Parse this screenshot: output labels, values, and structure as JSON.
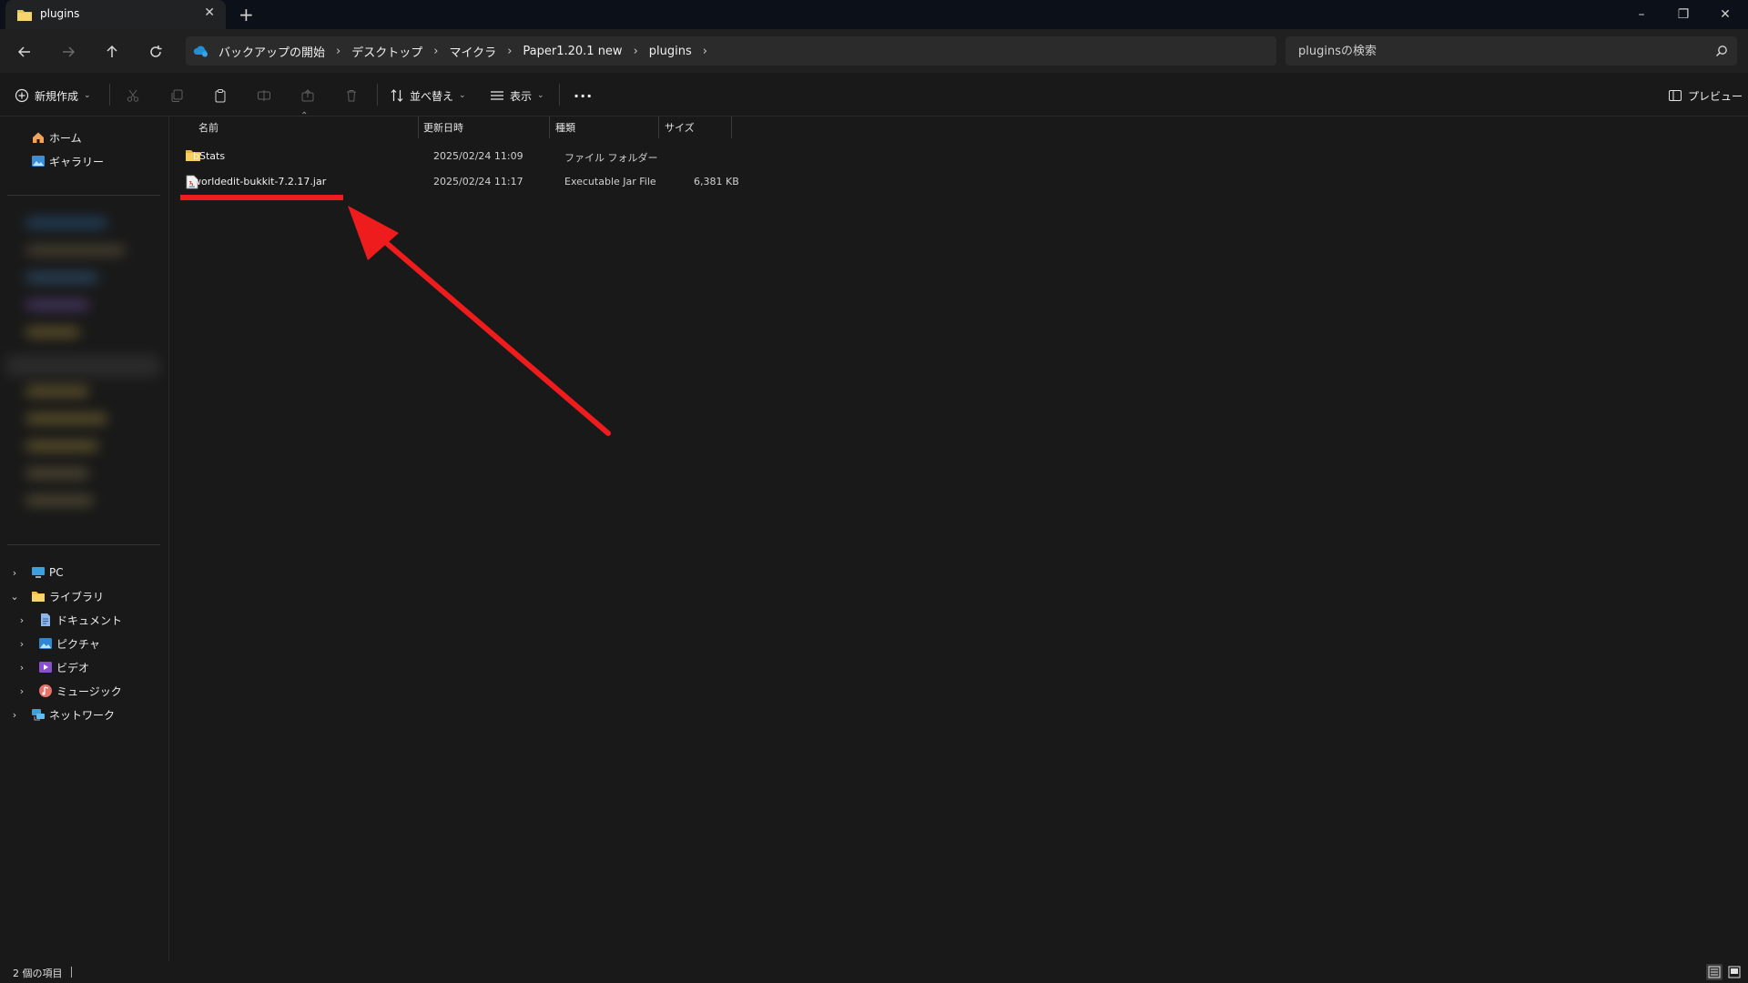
{
  "tab": {
    "title": "plugins",
    "close_glyph": "✕",
    "new_tab_glyph": "+"
  },
  "window_controls": {
    "minimize": "–",
    "maximize": "❐",
    "close": "✕"
  },
  "address": {
    "crumbs": [
      {
        "label": "バックアップの開始"
      },
      {
        "label": "デスクトップ"
      },
      {
        "label": "マイクラ"
      },
      {
        "label": "Paper1.20.1 new"
      },
      {
        "label": "plugins"
      }
    ],
    "separator": "›"
  },
  "search": {
    "placeholder": "pluginsの検索",
    "value": ""
  },
  "toolbar": {
    "new_label": "新規作成",
    "sort_label": "並べ替え",
    "view_label": "表示",
    "more_label": "···",
    "preview_label": "プレビュー"
  },
  "sidebar": {
    "home_label": "ホーム",
    "gallery_label": "ギャラリー",
    "pc_label": "PC",
    "library_label": "ライブラリ",
    "library_items": [
      {
        "label": "ドキュメント",
        "icon": "document-icon"
      },
      {
        "label": "ピクチャ",
        "icon": "pictures-icon"
      },
      {
        "label": "ビデオ",
        "icon": "videos-icon"
      },
      {
        "label": "ミュージック",
        "icon": "music-icon"
      }
    ],
    "network_label": "ネットワーク"
  },
  "columns": {
    "name": "名前",
    "modified": "更新日時",
    "type": "種類",
    "size": "サイズ"
  },
  "files": [
    {
      "name": "bStats",
      "modified": "2025/02/24 11:09",
      "type": "ファイル フォルダー",
      "size": "",
      "icon": "folder-icon"
    },
    {
      "name": "worldedit-bukkit-7.2.17.jar",
      "modified": "2025/02/24 11:17",
      "type": "Executable Jar File",
      "size": "6,381 KB",
      "icon": "jar-file-icon"
    }
  ],
  "status": {
    "item_count": "2 個の項目"
  },
  "colors": {
    "annotation": "#ee1c1c",
    "folder": "#f2c24a",
    "background": "#191919"
  }
}
